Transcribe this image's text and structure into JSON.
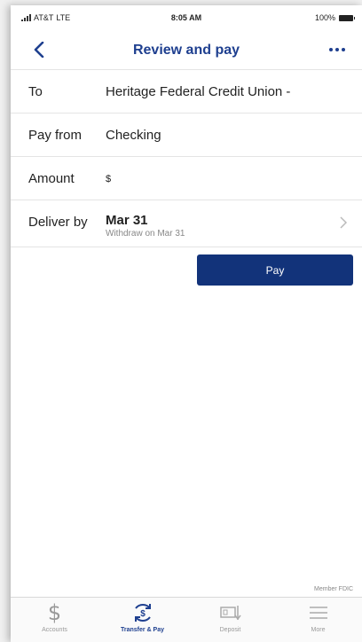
{
  "status": {
    "carrier": "AT&T",
    "network": "LTE",
    "time": "8:05 AM",
    "battery": "100%"
  },
  "nav": {
    "title": "Review and pay"
  },
  "form": {
    "to_label": "To",
    "to_value": "Heritage Federal Credit Union -",
    "payfrom_label": "Pay from",
    "payfrom_value": "Checking",
    "amount_label": "Amount",
    "amount_value": "$",
    "deliver_label": "Deliver by",
    "deliver_date": "Mar 31",
    "deliver_sub": "Withdraw on Mar 31"
  },
  "pay_button": "Pay",
  "footer_note": "Member FDIC",
  "tabs": [
    {
      "label": "Accounts",
      "icon": "dollar-icon"
    },
    {
      "label": "Transfer & Pay",
      "icon": "transfer-icon"
    },
    {
      "label": "Deposit",
      "icon": "deposit-icon"
    },
    {
      "label": "More",
      "icon": "menu-icon"
    }
  ],
  "colors": {
    "brand": "#1e3f8f",
    "button": "#12337a"
  }
}
